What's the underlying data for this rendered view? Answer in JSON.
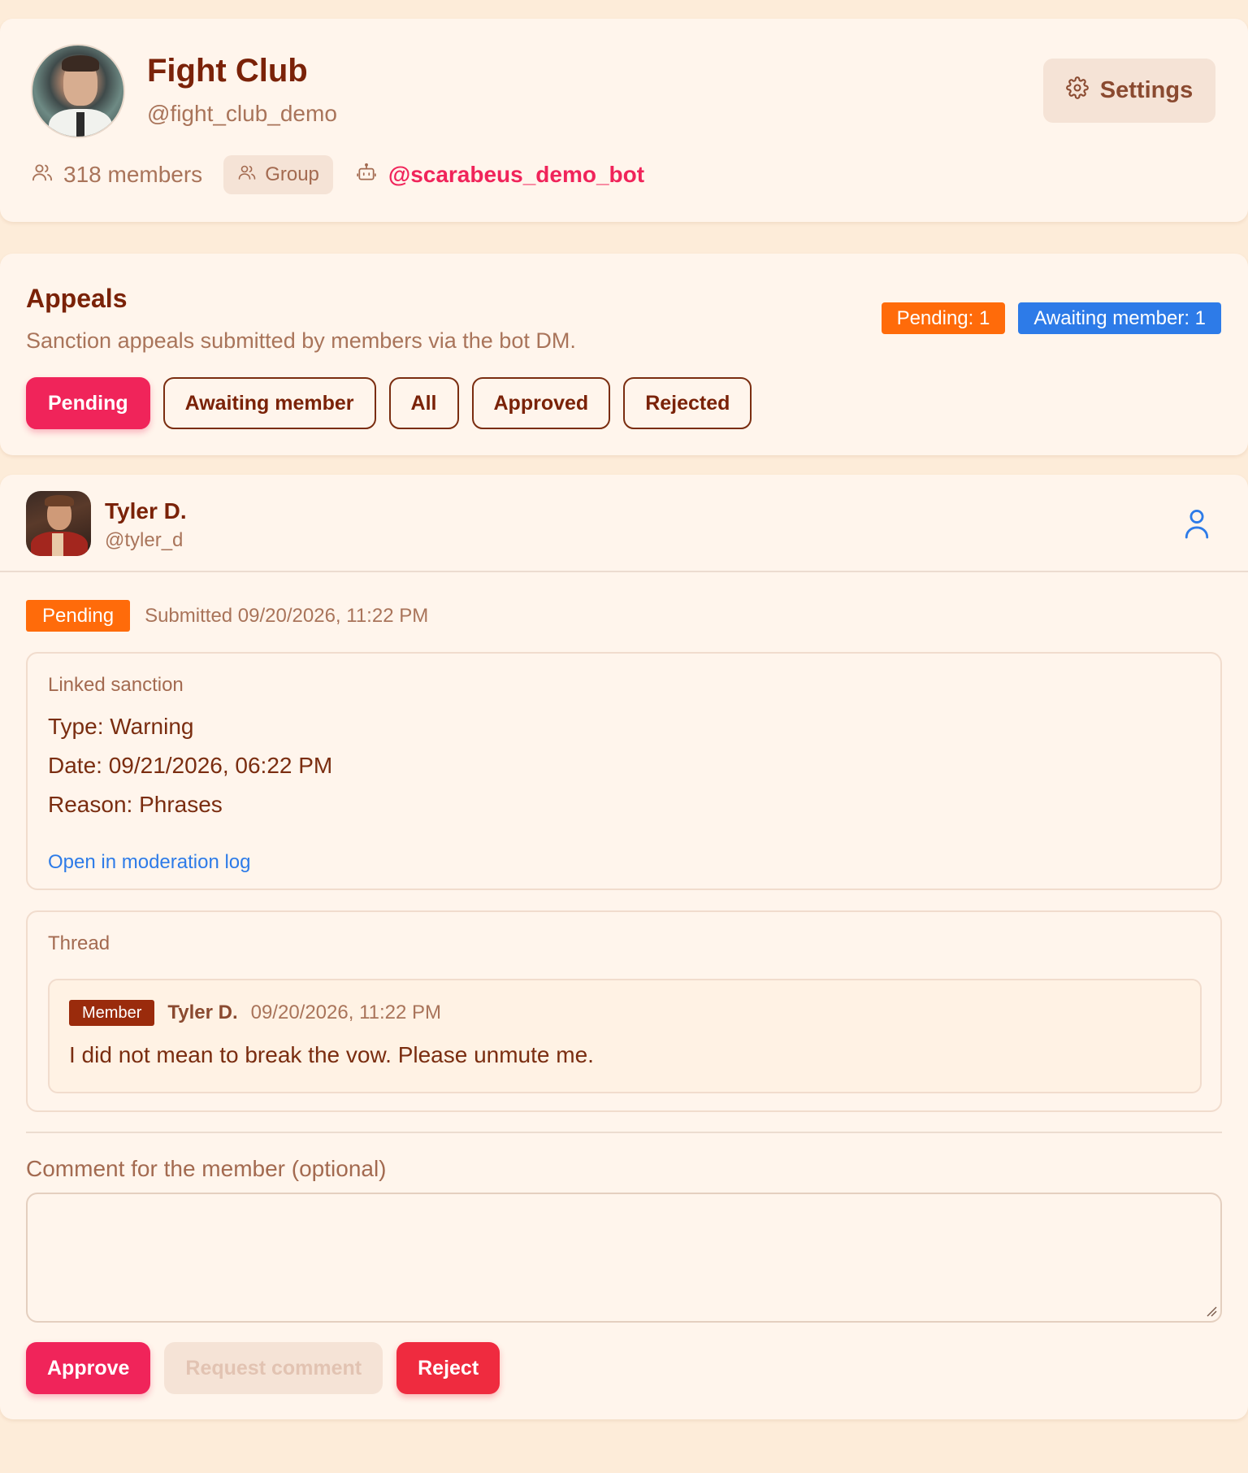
{
  "header": {
    "title": "Fight Club",
    "handle": "@fight_club_demo",
    "settings_label": "Settings",
    "members": "318 members",
    "chat_type": "Group",
    "bot_handle": "@scarabeus_demo_bot"
  },
  "appeals": {
    "title": "Appeals",
    "description": "Sanction appeals submitted by members via the bot DM.",
    "counts": [
      {
        "label": "Pending: 1",
        "color": "#ff6b0a"
      },
      {
        "label": "Awaiting member: 1",
        "color": "#2d7be8"
      }
    ],
    "filters": [
      {
        "label": "Pending",
        "active": true
      },
      {
        "label": "Awaiting member",
        "active": false
      },
      {
        "label": "All",
        "active": false
      },
      {
        "label": "Approved",
        "active": false
      },
      {
        "label": "Rejected",
        "active": false
      }
    ]
  },
  "appeal": {
    "user_name": "Tyler D.",
    "user_handle": "@tyler_d",
    "status": "Pending",
    "submitted": "Submitted 09/20/2026, 11:22 PM",
    "sanction": {
      "label": "Linked sanction",
      "type": "Type: Warning",
      "date": "Date: 09/21/2026, 06:22 PM",
      "reason": "Reason: Phrases",
      "link": "Open in moderation log"
    },
    "thread": {
      "label": "Thread",
      "messages": [
        {
          "role": "Member",
          "author": "Tyler D.",
          "time": "09/20/2026, 11:22 PM",
          "text": "I did not mean to break the vow. Please unmute me."
        }
      ]
    },
    "comment_label": "Comment for the member (optional)",
    "comment_value": "",
    "actions": {
      "approve": "Approve",
      "request": "Request comment",
      "reject": "Reject"
    }
  },
  "colors": {
    "accent": "#f0245a",
    "pending": "#ff6b0a",
    "info": "#2d7be8",
    "reject": "#ef2b3f"
  }
}
